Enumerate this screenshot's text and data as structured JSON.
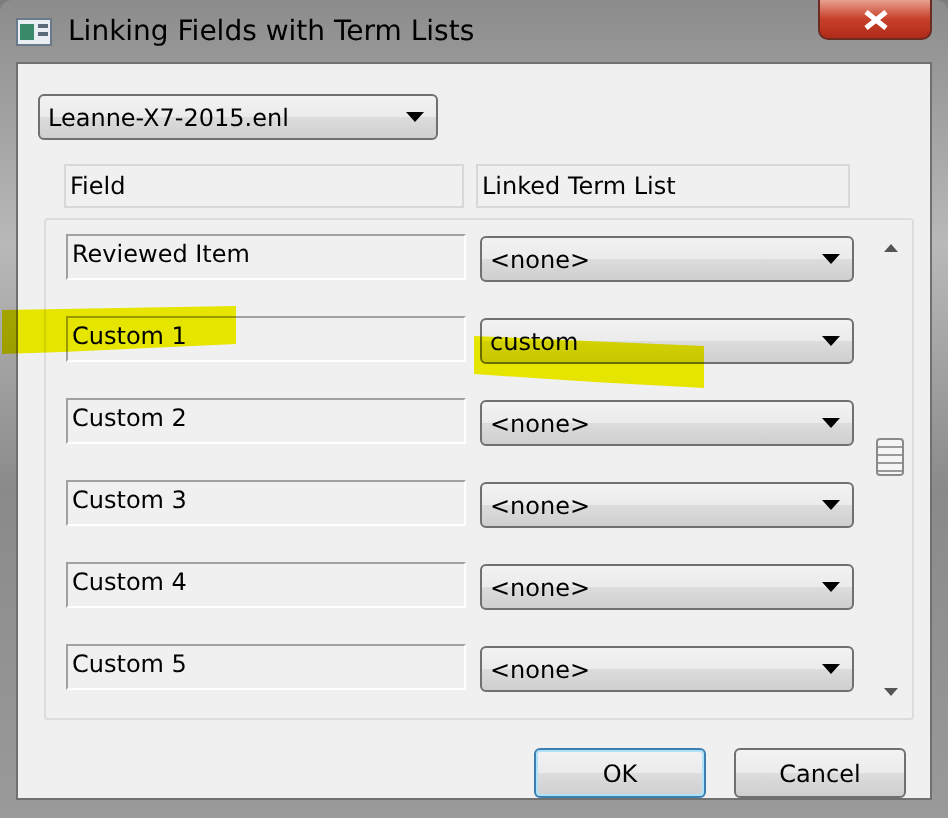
{
  "window": {
    "title": "Linking Fields with Term Lists"
  },
  "library": {
    "value": "Leanne-X7-2015.enl"
  },
  "columns": [
    "Field",
    "Linked Term List"
  ],
  "rows": [
    {
      "field": "Reviewed Item",
      "term_list": "<none>",
      "highlighted": false
    },
    {
      "field": "Custom 1",
      "term_list": "custom",
      "highlighted": true
    },
    {
      "field": "Custom 2",
      "term_list": "<none>",
      "highlighted": false
    },
    {
      "field": "Custom 3",
      "term_list": "<none>",
      "highlighted": false
    },
    {
      "field": "Custom 4",
      "term_list": "<none>",
      "highlighted": false
    },
    {
      "field": "Custom 5",
      "term_list": "<none>",
      "highlighted": false
    }
  ],
  "buttons": [
    {
      "label": "OK",
      "default": true
    },
    {
      "label": "Cancel",
      "default": false
    }
  ]
}
